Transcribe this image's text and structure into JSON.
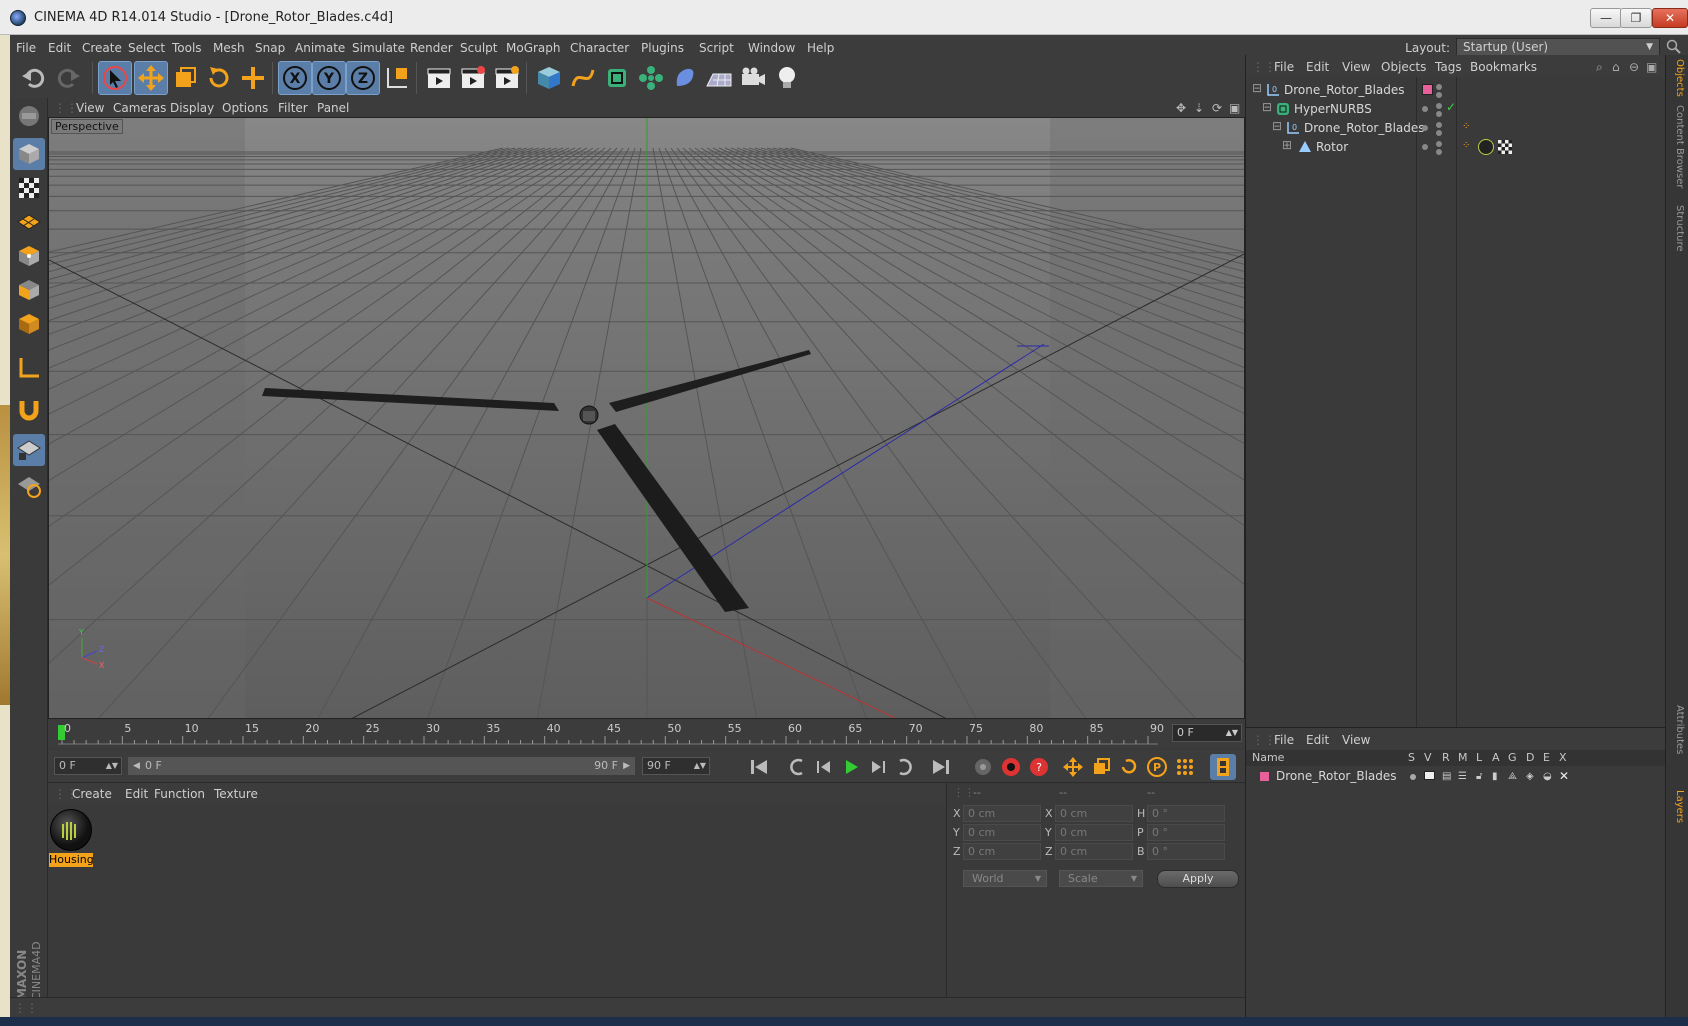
{
  "window": {
    "title": "CINEMA 4D R14.014 Studio - [Drone_Rotor_Blades.c4d]",
    "minimize": "—",
    "restore": "❐",
    "close": "✕"
  },
  "menubar": {
    "items": [
      "File",
      "Edit",
      "Create",
      "Select",
      "Tools",
      "Mesh",
      "Snap",
      "Animate",
      "Simulate",
      "Render",
      "Sculpt",
      "MoGraph",
      "Character",
      "Plugins",
      "Script",
      "Window",
      "Help"
    ],
    "layout_label": "Layout:",
    "layout_value": "Startup (User)"
  },
  "viewport": {
    "menu": [
      "View",
      "Cameras",
      "Display",
      "Options",
      "Filter",
      "Panel"
    ],
    "camera_label": "Perspective",
    "axis_labels": {
      "y": "Y",
      "z": "Z",
      "x": "X"
    }
  },
  "timeline": {
    "ticks": [
      "0",
      "5",
      "10",
      "15",
      "20",
      "25",
      "30",
      "35",
      "40",
      "45",
      "50",
      "55",
      "60",
      "65",
      "70",
      "75",
      "80",
      "85",
      "90"
    ],
    "current_frame": "0 F",
    "start_field": "0 F",
    "range_start": "0 F",
    "range_end": "90 F",
    "end_field": "90 F"
  },
  "materials": {
    "menu": [
      "Create",
      "Edit",
      "Function",
      "Texture"
    ],
    "items": [
      {
        "name": "Housing"
      }
    ]
  },
  "coordinates": {
    "headers": [
      "--",
      "--",
      "--"
    ],
    "rows": [
      {
        "l1": "X",
        "v1": "0 cm",
        "l2": "X",
        "v2": "0 cm",
        "l3": "H",
        "v3": "0 °"
      },
      {
        "l1": "Y",
        "v1": "0 cm",
        "l2": "Y",
        "v2": "0 cm",
        "l3": "P",
        "v3": "0 °"
      },
      {
        "l1": "Z",
        "v1": "0 cm",
        "l2": "Z",
        "v2": "0 cm",
        "l3": "B",
        "v3": "0 °"
      }
    ],
    "space_select": "World",
    "mode_select": "Scale",
    "apply_label": "Apply"
  },
  "object_manager": {
    "menu": [
      "File",
      "Edit",
      "View",
      "Objects",
      "Tags",
      "Bookmarks"
    ],
    "objects": [
      {
        "name": "Drone_Rotor_Blades",
        "type": "null"
      },
      {
        "name": "HyperNURBS",
        "type": "hypernurbs"
      },
      {
        "name": "Drone_Rotor_Blades",
        "type": "null"
      },
      {
        "name": "Rotor",
        "type": "polygon"
      }
    ]
  },
  "layer_manager": {
    "menu": [
      "File",
      "Edit",
      "View"
    ],
    "columns": [
      "Name",
      "S",
      "V",
      "R",
      "M",
      "L",
      "A",
      "G",
      "D",
      "E",
      "X"
    ],
    "layers": [
      {
        "name": "Drone_Rotor_Blades",
        "color": "#e8609a"
      }
    ]
  },
  "side_tabs": [
    "Objects",
    "Content Browser",
    "Structure",
    "Attributes",
    "Layers"
  ],
  "colors": {
    "accent": "#f3a21c",
    "selection": "#5b7ea8",
    "layer_pink": "#e8609a"
  }
}
